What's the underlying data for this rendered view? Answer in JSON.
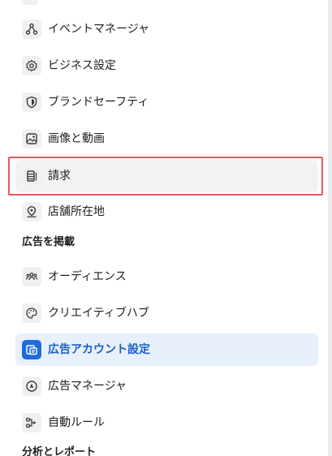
{
  "menu": {
    "items_top": [
      {
        "label": "イベントマネージャ",
        "icon": "share-nodes-icon"
      },
      {
        "label": "ビジネス設定",
        "icon": "gear-icon"
      },
      {
        "label": "ブランドセーフティ",
        "icon": "shield-icon"
      },
      {
        "label": "画像と動画",
        "icon": "image-icon"
      },
      {
        "label": "請求",
        "icon": "billing-stack-icon"
      },
      {
        "label": "店舗所在地",
        "icon": "location-pin-icon"
      }
    ],
    "section_ads": "広告を掲載",
    "items_ads": [
      {
        "label": "オーディエンス",
        "icon": "people-icon"
      },
      {
        "label": "クリエイティブハブ",
        "icon": "palette-icon"
      },
      {
        "label": "広告アカウント設定",
        "icon": "ad-account-icon",
        "active": true
      },
      {
        "label": "広告マネージャ",
        "icon": "compass-icon"
      },
      {
        "label": "自動ルール",
        "icon": "flow-rules-icon"
      }
    ],
    "section_analytics": "分析とレポート"
  },
  "colors": {
    "accent": "#1e6ddb",
    "active_bg": "#e7f0fb",
    "active_text": "#1a5fcb",
    "highlight_border": "#e5595c",
    "hover_bg": "#f2f2f2"
  }
}
